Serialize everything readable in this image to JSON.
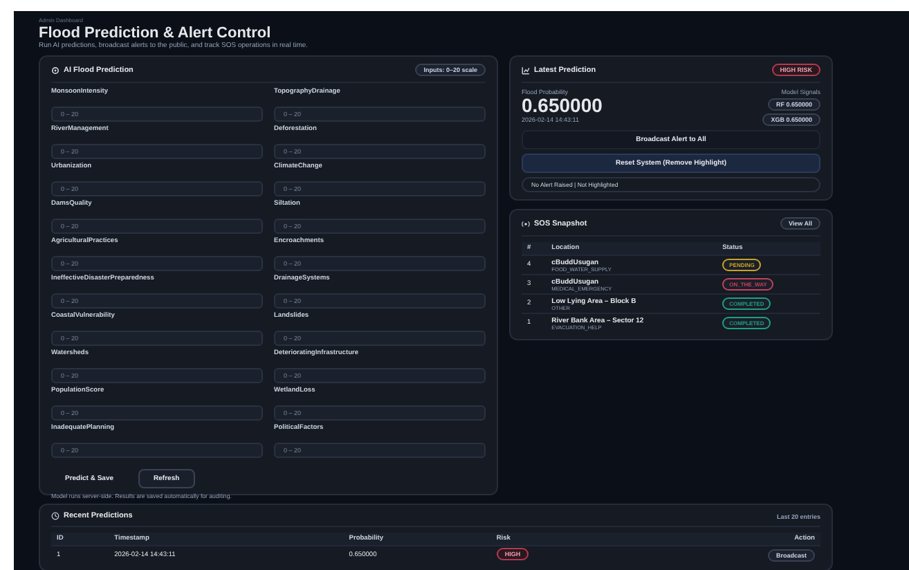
{
  "breadcrumb": "Admin Dashboard",
  "title": "Flood Prediction & Alert Control",
  "subtitle": "Run AI predictions, broadcast alerts to the public, and track SOS operations in real time.",
  "prediction_form": {
    "title": "AI Flood Prediction",
    "badge": "Inputs: 0–20 scale",
    "fields": [
      {
        "label": "MonsoonIntensity",
        "placeholder": "0 – 20"
      },
      {
        "label": "TopographyDrainage",
        "placeholder": "0 – 20"
      },
      {
        "label": "RiverManagement",
        "placeholder": "0 – 20"
      },
      {
        "label": "Deforestation",
        "placeholder": "0 – 20"
      },
      {
        "label": "Urbanization",
        "placeholder": "0 – 20"
      },
      {
        "label": "ClimateChange",
        "placeholder": "0 – 20"
      },
      {
        "label": "DamsQuality",
        "placeholder": "0 – 20"
      },
      {
        "label": "Siltation",
        "placeholder": "0 – 20"
      },
      {
        "label": "AgriculturalPractices",
        "placeholder": "0 – 20"
      },
      {
        "label": "Encroachments",
        "placeholder": "0 – 20"
      },
      {
        "label": "IneffectiveDisasterPreparedness",
        "placeholder": "0 – 20"
      },
      {
        "label": "DrainageSystems",
        "placeholder": "0 – 20"
      },
      {
        "label": "CoastalVulnerability",
        "placeholder": "0 – 20"
      },
      {
        "label": "Landslides",
        "placeholder": "0 – 20"
      },
      {
        "label": "Watersheds",
        "placeholder": "0 – 20"
      },
      {
        "label": "DeterioratingInfrastructure",
        "placeholder": "0 – 20"
      },
      {
        "label": "PopulationScore",
        "placeholder": "0 – 20"
      },
      {
        "label": "WetlandLoss",
        "placeholder": "0 – 20"
      },
      {
        "label": "InadequatePlanning",
        "placeholder": "0 – 20"
      },
      {
        "label": "PoliticalFactors",
        "placeholder": "0 – 20"
      }
    ],
    "buttons": [
      {
        "label": "Predict & Save",
        "kind": "primary"
      },
      {
        "label": "Refresh",
        "kind": "outline"
      }
    ],
    "note": "Model runs server-side. Results are saved automatically for auditing."
  },
  "latest_prediction": {
    "title": "Latest Prediction",
    "risk_badge": "HIGH RISK",
    "probability_label": "Flood Probability",
    "probability": "0.650000",
    "timestamp": "2026-02-14 14:43:11",
    "signals_label": "Model Signals",
    "signals": [
      "RF 0.650000",
      "XGB 0.650000"
    ],
    "broadcast_button": "Broadcast Alert to All",
    "reset_button": "Reset System (Remove Highlight)",
    "status_line": "No Alert Raised | Not Highlighted"
  },
  "sos_snapshot": {
    "title": "SOS Snapshot",
    "view_all": "View All",
    "columns": [
      "#",
      "Location",
      "Status"
    ],
    "rows": [
      {
        "id": "4",
        "location": "cBuddUsugan",
        "detail": "FOOD_WATER_SUPPLY",
        "status": "PENDING",
        "color": "#c9a227"
      },
      {
        "id": "3",
        "location": "cBuddUsugan",
        "detail": "MEDICAL_EMERGENCY",
        "status": "ON_THE_WAY",
        "color": "#c2415a"
      },
      {
        "id": "2",
        "location": "Low Lying Area – Block B",
        "detail": "OTHER",
        "status": "COMPLETED",
        "color": "#1f9e84"
      },
      {
        "id": "1",
        "location": "River Bank Area – Sector 12",
        "detail": "EVACUATION_HELP",
        "status": "COMPLETED",
        "color": "#1f9e84"
      }
    ]
  },
  "recent_predictions": {
    "title": "Recent Predictions",
    "meta": "Last 20 entries",
    "columns": [
      "ID",
      "Timestamp",
      "Probability",
      "Risk",
      "Action"
    ],
    "rows": [
      {
        "id": "1",
        "timestamp": "2026-02-14 14:43:11",
        "probability": "0.650000",
        "risk": "HIGH",
        "action": "Broadcast"
      }
    ]
  }
}
